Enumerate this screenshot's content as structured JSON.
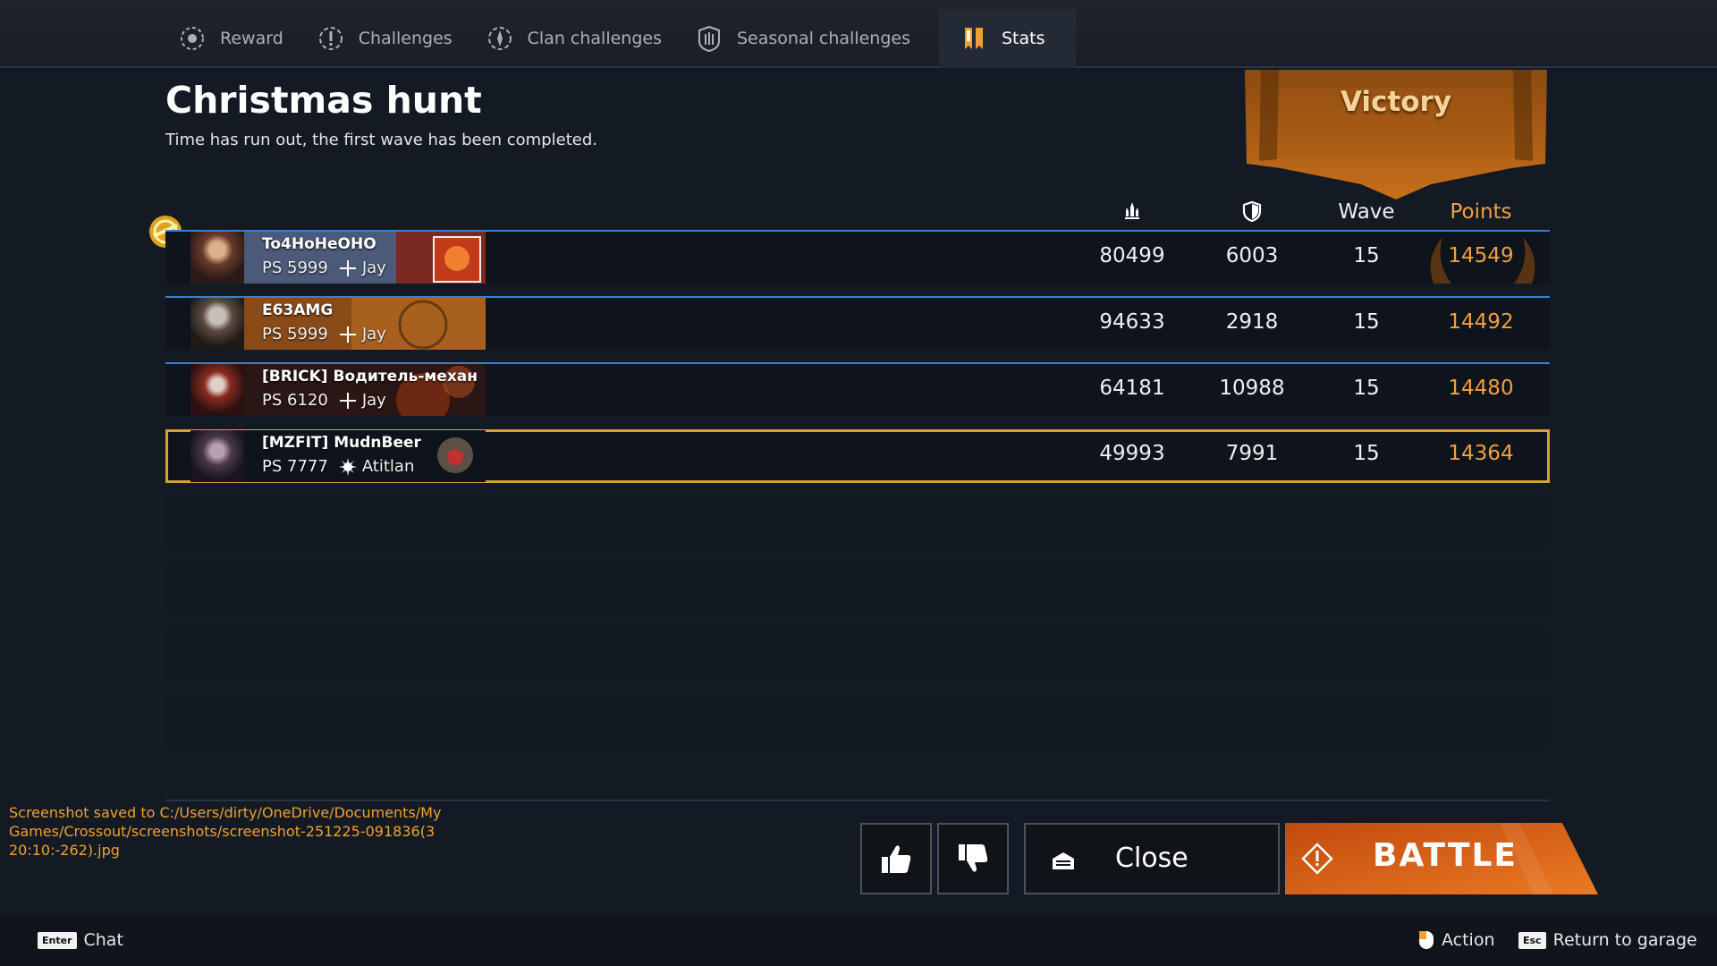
{
  "tabs": [
    {
      "label": "Reward",
      "icon": "reward-icon"
    },
    {
      "label": "Challenges",
      "icon": "challenges-icon"
    },
    {
      "label": "Clan challenges",
      "icon": "clan-challenges-icon"
    },
    {
      "label": "Seasonal challenges",
      "icon": "seasonal-challenges-icon"
    },
    {
      "label": "Stats",
      "icon": "stats-icon",
      "active": true
    }
  ],
  "header": {
    "title": "Christmas hunt",
    "subtitle": "Time has run out, the first wave has been completed.",
    "result": "Victory"
  },
  "table": {
    "columns": {
      "damage_icon": "damage-icon",
      "defense_icon": "shield-icon",
      "wave": "Wave",
      "points": "Points"
    },
    "rows": [
      {
        "name": "To4HoHeOHO",
        "ps": "PS 5999",
        "faction": "Jay",
        "damage": "80499",
        "defense": "6003",
        "wave": "15",
        "points": "14549"
      },
      {
        "name": "E63AMG",
        "ps": "PS 5999",
        "faction": "Jay",
        "damage": "94633",
        "defense": "2918",
        "wave": "15",
        "points": "14492"
      },
      {
        "name": "[BRICK] Водитель-механ",
        "ps": "PS 6120",
        "faction": "Jay",
        "damage": "64181",
        "defense": "10988",
        "wave": "15",
        "points": "14480"
      },
      {
        "name": "[MZFIT] MudnBeer",
        "ps": "PS 7777",
        "faction": "Atitlan",
        "damage": "49993",
        "defense": "7991",
        "wave": "15",
        "points": "14364"
      }
    ]
  },
  "screenshot_note": "Screenshot saved to C:/Users/dirty/OneDrive/Documents/My Games/Crossout/screenshots/screenshot-251225-091836(3 20:10:-262).jpg",
  "buttons": {
    "close": "Close",
    "battle": "BATTLE"
  },
  "footer": {
    "chat_key": "Enter",
    "chat": "Chat",
    "action": "Action",
    "return_key": "Esc",
    "return": "Return to garage"
  },
  "colors": {
    "accent": "#f0a040",
    "row_border": "#3a7fd0",
    "highlight": "#d6a13a",
    "battle": "#e0661a"
  }
}
